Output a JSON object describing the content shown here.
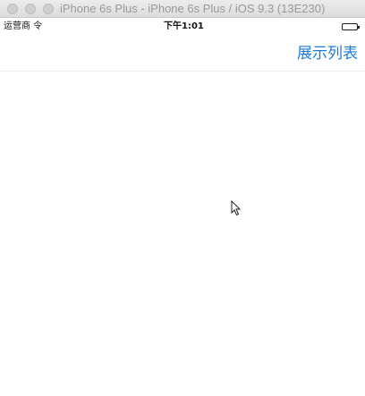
{
  "window": {
    "title": "iPhone 6s Plus - iPhone 6s Plus / iOS 9.3 (13E230)"
  },
  "status_bar": {
    "carrier": "运营商 令",
    "time": "下午1:01"
  },
  "nav_bar": {
    "right_button_label": "展示列表"
  },
  "colors": {
    "accent": "#1d7bd8",
    "background": "#ffffff",
    "title_text": "#9a9a9a"
  }
}
